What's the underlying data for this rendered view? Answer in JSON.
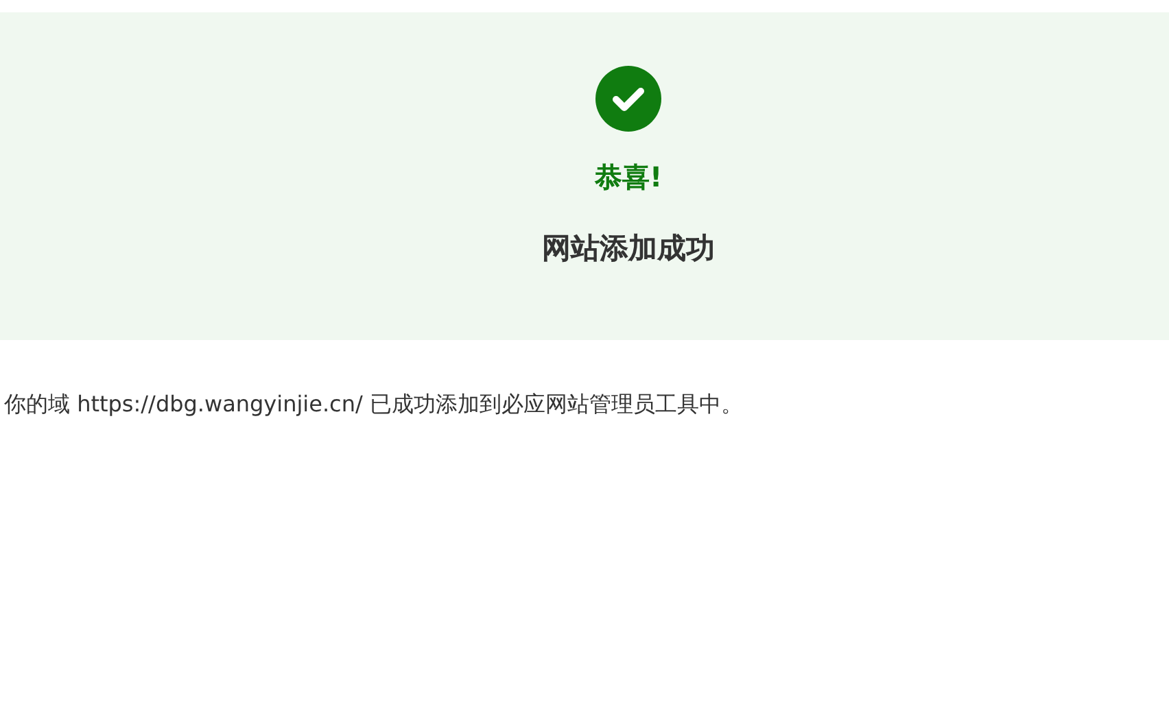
{
  "banner": {
    "kind": "success",
    "heading": "恭喜!",
    "title": "网站添加成功"
  },
  "message": "你的域 https://dbg.wangyinjie.cn/ 已成功添加到必应网站管理员工具中。"
}
